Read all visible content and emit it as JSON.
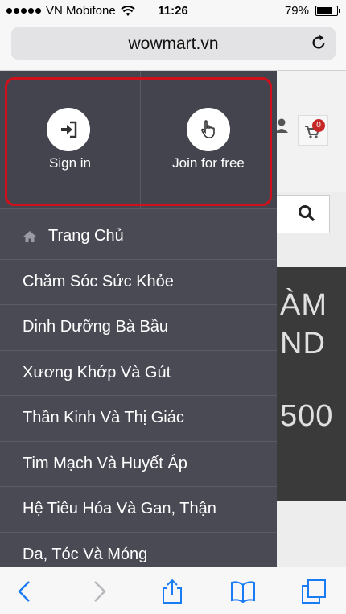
{
  "status_bar": {
    "carrier": "VN Mobifone",
    "time": "11:26",
    "battery": "79%",
    "battery_level": 0.79
  },
  "address_bar": {
    "url": "wowmart.vn"
  },
  "background_site": {
    "cart_count": "0",
    "banner_lines": [
      "ÀM",
      "ND",
      "500"
    ]
  },
  "drawer": {
    "sign_in_label": "Sign in",
    "join_label": "Join for free",
    "menu_items": [
      {
        "label": "Trang Chủ",
        "icon": "home-icon"
      },
      {
        "label": "Chăm Sóc Sức Khỏe"
      },
      {
        "label": "Dinh Dưỡng Bà Bầu"
      },
      {
        "label": "Xương Khớp Và Gút"
      },
      {
        "label": "Thần Kinh Và Thị Giác"
      },
      {
        "label": "Tim Mạch Và Huyết Áp"
      },
      {
        "label": "Hệ Tiêu Hóa Và Gan, Thận"
      },
      {
        "label": "Da, Tóc Và Móng"
      }
    ]
  },
  "colors": {
    "drawer_bg": "#4a4a55",
    "highlight": "#d0111c",
    "ios_blue": "#1a7cf4"
  }
}
